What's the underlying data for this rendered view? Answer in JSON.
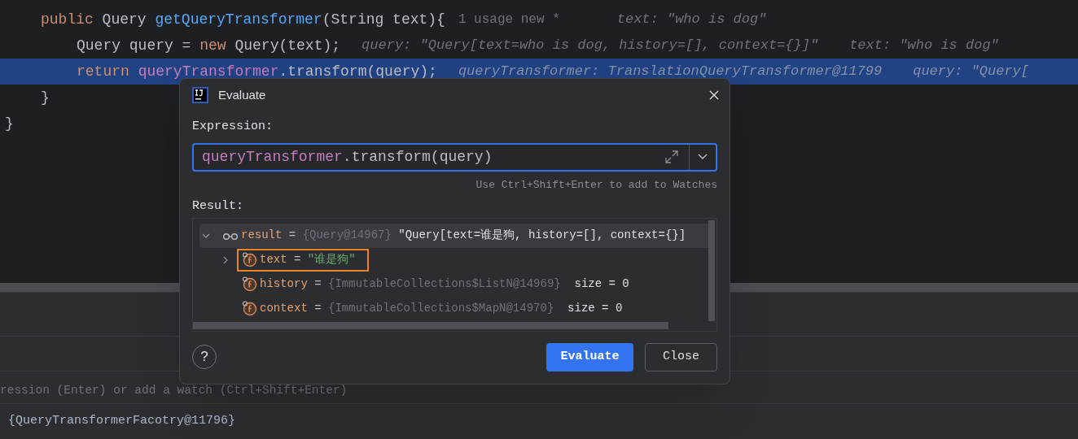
{
  "editor": {
    "lines": [
      {
        "children": [
          {
            "selected": false,
            "segments": [
              {
                "kind": "keyword",
                "text": "public"
              },
              {
                "kind": "plain",
                "text": " Query "
              },
              {
                "kind": "method",
                "text": "getQueryTransformer"
              },
              {
                "kind": "plain",
                "text": "(String text){"
              }
            ],
            "hints": [
              {
                "kind": "usage",
                "text": "1 usage  new *"
              },
              {
                "kind": "value",
                "text": "text: \"who is dog\""
              }
            ],
            "children": [
              {
                "selected": false,
                "segments": [
                  {
                    "kind": "plain",
                    "text": "Query query = "
                  },
                  {
                    "kind": "keyword",
                    "text": "new"
                  },
                  {
                    "kind": "plain",
                    "text": " Query(text);"
                  }
                ],
                "hints": [
                  {
                    "kind": "value",
                    "text": "query: \"Query[text=who is dog, history=[], context={}]\""
                  },
                  {
                    "kind": "value",
                    "text": "text: \"who is dog\""
                  }
                ]
              },
              {
                "selected": true,
                "segments": [
                  {
                    "kind": "keyword",
                    "text": "return "
                  },
                  {
                    "kind": "field",
                    "text": "queryTransformer"
                  },
                  {
                    "kind": "plain",
                    "text": ".transform(query);"
                  }
                ],
                "hints": [
                  {
                    "kind": "value",
                    "text": "queryTransformer: TranslationQueryTransformer@11799"
                  },
                  {
                    "kind": "value",
                    "text": "query: \"Query["
                  }
                ]
              }
            ]
          },
          {
            "selected": false,
            "segments": [
              {
                "kind": "plain",
                "text": "}"
              }
            ]
          }
        ]
      },
      {
        "selected": false,
        "segments": [
          {
            "kind": "plain",
            "text": "}"
          }
        ]
      }
    ]
  },
  "dialog": {
    "title": "Evaluate",
    "expression_label": "Expression:",
    "expression": [
      {
        "kind": "field",
        "text": "queryTransformer"
      },
      {
        "kind": "plain",
        "text": ".transform(query)"
      }
    ],
    "watch_hint": "Use Ctrl+Shift+Enter to add to Watches",
    "result_label": "Result:",
    "tree": [
      {
        "kind": "watch",
        "name": "result",
        "op": "=",
        "ref": "{Query@14967}",
        "value": "\"Query[text=谁是狗, history=[], context={}]",
        "expanded": true,
        "selected": true,
        "highlighted": false,
        "children": [
          {
            "kind": "field",
            "name": "text",
            "op": "=",
            "value": "\"谁是狗\"",
            "expandable": true,
            "expanded": false,
            "selected": false,
            "highlighted": true
          },
          {
            "kind": "field",
            "name": "history",
            "op": "=",
            "ref": "{ImmutableCollections$ListN@14969}",
            "size": "size = 0",
            "expandable": false,
            "selected": false,
            "highlighted": false
          },
          {
            "kind": "field",
            "name": "context",
            "op": "=",
            "ref": "{ImmutableCollections$MapN@14970}",
            "size": "size = 0",
            "expandable": false,
            "selected": false,
            "highlighted": false
          }
        ]
      }
    ],
    "help": "?",
    "buttons": [
      {
        "kind": "primary",
        "label": "Evaluate"
      },
      {
        "kind": "secondary",
        "label": "Close"
      }
    ]
  },
  "console": {
    "hint": "ression (Enter) or add a watch (Ctrl+Shift+Enter)",
    "value": "{QueryTransformerFacotry@11796}"
  }
}
